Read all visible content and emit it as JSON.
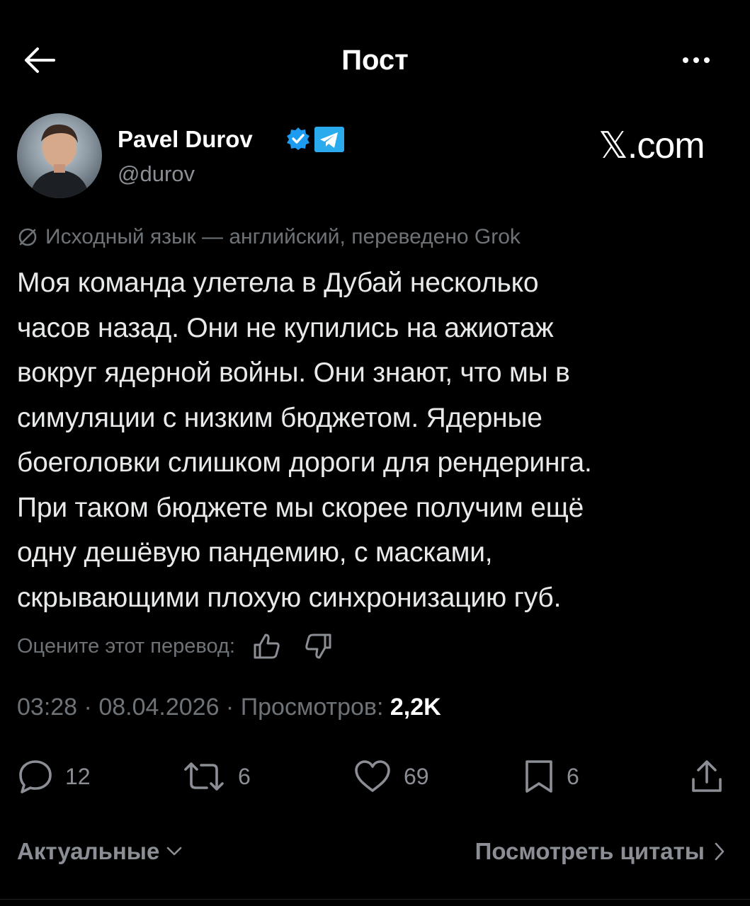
{
  "header": {
    "title": "Пост",
    "back_icon": "arrow-left-icon",
    "more_icon": "more-horizontal-icon"
  },
  "author": {
    "name": "Pavel Durov",
    "handle": "@durov",
    "verified_icon": "verified-check-icon",
    "affiliation_icon": "telegram-icon",
    "verified_color": "#1d9bf0",
    "telegram_color": "#2aabee"
  },
  "watermark": "𝕏.com",
  "translation_notice": {
    "icon": "translate-icon",
    "text": "Исходный язык — английский, переведено Grok"
  },
  "post": {
    "text": "Моя команда улетела в Дубай несколько\nчасов назад. Они не купились на ажиотаж\nвокруг ядерной войны. Они знают, что мы в\nсимуляции с низким бюджетом. Ядерные\nбоеголовки слишком дороги для рендеринга.\nПри таком бюджете мы скорее получим ещё\nодну дешёвую пандемию, с масками,\nскрывающими плохую синхронизацию губ."
  },
  "rate_translation": {
    "label": "Оцените этот перевод:",
    "thumbs_up_icon": "thumbs-up-icon",
    "thumbs_down_icon": "thumbs-down-icon"
  },
  "meta": {
    "time": "03:28",
    "separator": " · ",
    "date": "08.04.2026",
    "views_label": "Просмотров:",
    "views_count": "2,2K"
  },
  "actions": {
    "reply": {
      "icon": "reply-icon",
      "count": "12"
    },
    "repost": {
      "icon": "repost-icon",
      "count": "6"
    },
    "like": {
      "icon": "heart-icon",
      "count": "69"
    },
    "bookmark": {
      "icon": "bookmark-icon",
      "count": "6"
    },
    "share": {
      "icon": "share-icon"
    }
  },
  "footer": {
    "sort_label": "Актуальные",
    "quotes_label": "Посмотреть цитаты"
  },
  "colors": {
    "background": "#000000",
    "text": "#e7e9ea",
    "muted": "#8b8f95",
    "accent": "#1d9bf0"
  }
}
